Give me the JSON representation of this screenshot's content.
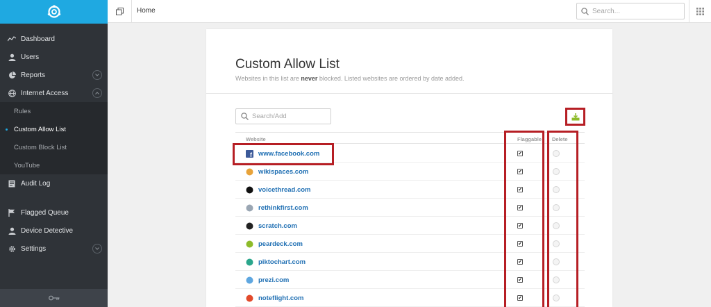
{
  "sidebar": {
    "items": [
      {
        "label": "Dashboard",
        "icon": "dashboard-icon"
      },
      {
        "label": "Users",
        "icon": "user-icon"
      },
      {
        "label": "Reports",
        "icon": "pie-chart-icon",
        "chevron": "down"
      },
      {
        "label": "Internet Access",
        "icon": "globe-icon",
        "chevron": "up"
      }
    ],
    "sub_items": [
      {
        "label": "Rules",
        "active": false
      },
      {
        "label": "Custom Allow List",
        "active": true
      },
      {
        "label": "Custom Block List",
        "active": false
      },
      {
        "label": "YouTube",
        "active": false
      }
    ],
    "items2": [
      {
        "label": "Audit Log",
        "icon": "log-icon"
      }
    ],
    "items3": [
      {
        "label": "Flagged Queue",
        "icon": "flag-icon"
      },
      {
        "label": "Device Detective",
        "icon": "user-icon"
      },
      {
        "label": "Settings",
        "icon": "gear-icon",
        "chevron": "down"
      }
    ],
    "footer_icon": "key-icon"
  },
  "topbar": {
    "breadcrumb": "Home",
    "search_placeholder": "Search..."
  },
  "page": {
    "title": "Custom Allow List",
    "subtitle_pre": "Websites in this list are ",
    "subtitle_bold": "never",
    "subtitle_post": " blocked. Listed websites are ordered by date added.",
    "search_placeholder": "Search/Add",
    "export_icon": "export-icon"
  },
  "table": {
    "headers": {
      "website": "Website",
      "flaggable": "Flaggable",
      "delete": "Delete"
    },
    "rows": [
      {
        "site": "www.facebook.com",
        "flaggable": true,
        "icon_color": "#3b5998"
      },
      {
        "site": "wikispaces.com",
        "flaggable": true,
        "icon_color": "#e8a33a"
      },
      {
        "site": "voicethread.com",
        "flaggable": true,
        "icon_color": "#111111"
      },
      {
        "site": "rethinkfirst.com",
        "flaggable": true,
        "icon_color": "#9aa6b3"
      },
      {
        "site": "scratch.com",
        "flaggable": true,
        "icon_color": "#222222"
      },
      {
        "site": "peardeck.com",
        "flaggable": true,
        "icon_color": "#8dbb2a"
      },
      {
        "site": "piktochart.com",
        "flaggable": true,
        "icon_color": "#2aa68c"
      },
      {
        "site": "prezi.com",
        "flaggable": true,
        "icon_color": "#5fa7e0"
      },
      {
        "site": "noteflight.com",
        "flaggable": true,
        "icon_color": "#e24a2b"
      }
    ]
  },
  "colors": {
    "accent": "#1fa9e1",
    "highlight": "#b61e24",
    "link": "#1f6fb3",
    "export_green": "#8dbb2a"
  }
}
